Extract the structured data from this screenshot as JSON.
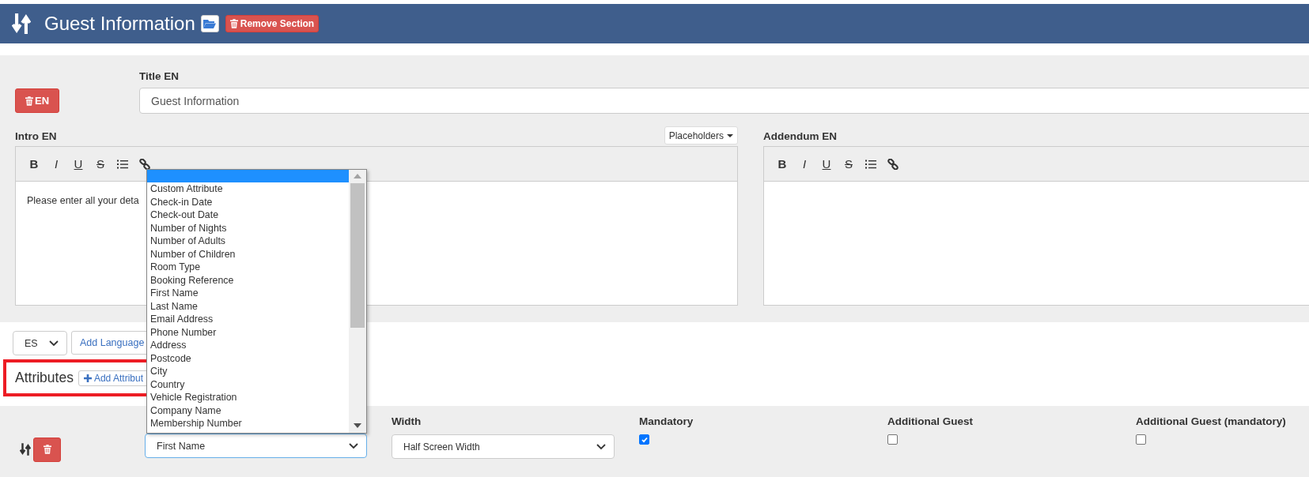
{
  "section": {
    "title": "Guest Information",
    "remove_label": "Remove Section"
  },
  "language": {
    "delete_label": "EN",
    "title_label": "Title EN",
    "title_value": "Guest Information",
    "intro_label": "Intro EN",
    "placeholders_label": "Placeholders",
    "intro_text": "Please enter all your deta",
    "addendum_label": "Addendum EN"
  },
  "intro_toolbar": [
    {
      "kind": "bold",
      "label": "B"
    },
    {
      "kind": "italic",
      "label": "I"
    },
    {
      "kind": "underline",
      "label": "U"
    },
    {
      "kind": "strike",
      "label": "S"
    },
    {
      "kind": "list"
    },
    {
      "kind": "link"
    }
  ],
  "addendum_toolbar": [
    {
      "kind": "bold",
      "label": "B"
    },
    {
      "kind": "italic",
      "label": "I"
    },
    {
      "kind": "underline",
      "label": "U"
    },
    {
      "kind": "strike",
      "label": "S"
    },
    {
      "kind": "list"
    },
    {
      "kind": "link"
    }
  ],
  "language_select": {
    "value": "ES"
  },
  "add_language_label": "Add Language",
  "attributes": {
    "heading": "Attributes",
    "add_label": "Add Attribut",
    "highlighted": true
  },
  "attribute_row": {
    "attribute_value": "First Name",
    "width_label": "Width",
    "width_value": "Half Screen Width",
    "flags": [
      {
        "label": "Mandatory",
        "checked": true
      },
      {
        "label": "Additional Guest",
        "checked": false
      },
      {
        "label": "Additional Guest (mandatory)",
        "checked": false
      }
    ]
  },
  "dropdown": {
    "blank_highlighted": true,
    "options": [
      {
        "label": "Custom Attribute",
        "selected": false
      },
      {
        "label": "Check-in Date",
        "selected": false
      },
      {
        "label": "Check-out Date",
        "selected": false
      },
      {
        "label": "Number of Nights",
        "selected": false
      },
      {
        "label": "Number of Adults",
        "selected": false
      },
      {
        "label": "Number of Children",
        "selected": false
      },
      {
        "label": "Room Type",
        "selected": false
      },
      {
        "label": "Booking Reference",
        "selected": false
      },
      {
        "label": "First Name",
        "selected": false
      },
      {
        "label": "Last Name",
        "selected": false
      },
      {
        "label": "Email Address",
        "selected": false
      },
      {
        "label": "Phone Number",
        "selected": false
      },
      {
        "label": "Address",
        "selected": false
      },
      {
        "label": "Postcode",
        "selected": false
      },
      {
        "label": "City",
        "selected": false
      },
      {
        "label": "Country",
        "selected": false
      },
      {
        "label": "Vehicle Registration",
        "selected": false
      },
      {
        "label": "Company Name",
        "selected": false
      },
      {
        "label": "Membership Number",
        "selected": false
      }
    ]
  }
}
